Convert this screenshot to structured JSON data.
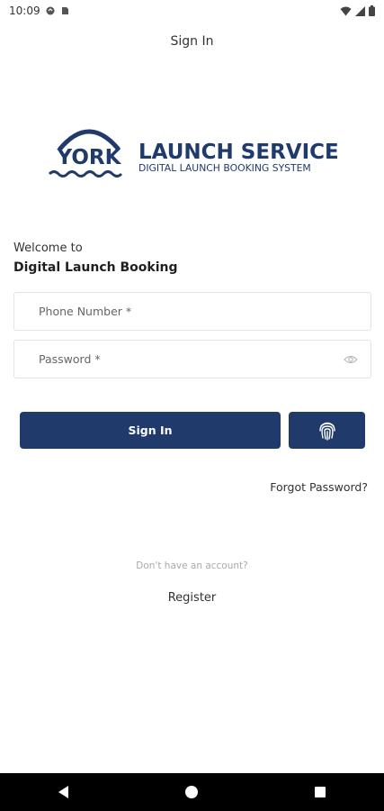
{
  "status_bar": {
    "time": "10:09"
  },
  "header": {
    "title": "Sign In"
  },
  "logo": {
    "brand": "YORK",
    "service": "LAUNCH SERVICE",
    "tagline": "DIGITAL LAUNCH BOOKING SYSTEM",
    "color": "#1f3a6b"
  },
  "welcome": {
    "label": "Welcome to",
    "title": "Digital Launch Booking"
  },
  "form": {
    "phone_placeholder": "Phone Number *",
    "password_placeholder": "Password *"
  },
  "actions": {
    "sign_in_label": "Sign In",
    "biometric_icon": "fingerprint-icon",
    "forgot_password": "Forgot Password?"
  },
  "footer": {
    "no_account_text": "Don't have an account?",
    "register_label": "Register"
  },
  "colors": {
    "primary": "#1f3a6b",
    "muted_text": "#aaaaaa",
    "field_border": "#e3e3e3"
  }
}
